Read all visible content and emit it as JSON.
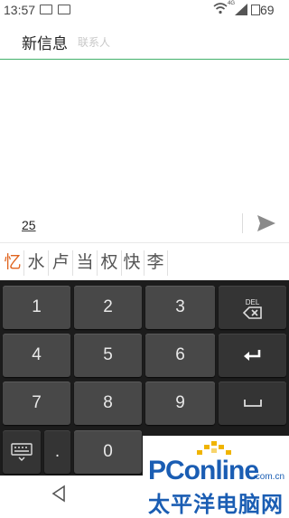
{
  "status_bar": {
    "time": "13:57",
    "network_label": "4G",
    "battery_level": "69"
  },
  "header": {
    "title": "新信息",
    "hint": "联系人"
  },
  "composer": {
    "text": "25",
    "send_icon": "send-icon"
  },
  "candidates": [
    "忆",
    "水",
    "卢",
    "当",
    "权",
    "快",
    "李"
  ],
  "keyboard": {
    "rows": [
      [
        "1",
        "2",
        "3"
      ],
      [
        "4",
        "5",
        "6"
      ],
      [
        "7",
        "8",
        "9"
      ]
    ],
    "del_label": "DEL",
    "dot_label": ".",
    "zero_label": "0",
    "icons": [
      "backspace-icon",
      "enter-icon",
      "space-icon",
      "keyboard-switch-icon"
    ]
  },
  "watermark": {
    "brand": "PConline",
    "domain": ".com.cn",
    "subtitle": "太平洋电脑网"
  },
  "colors": {
    "accent_green": "#43b06b",
    "active_candidate": "#e0641e",
    "keyboard_bg": "#1c1c1c",
    "key_bg": "#484848",
    "brand_blue": "#1a5db3"
  }
}
